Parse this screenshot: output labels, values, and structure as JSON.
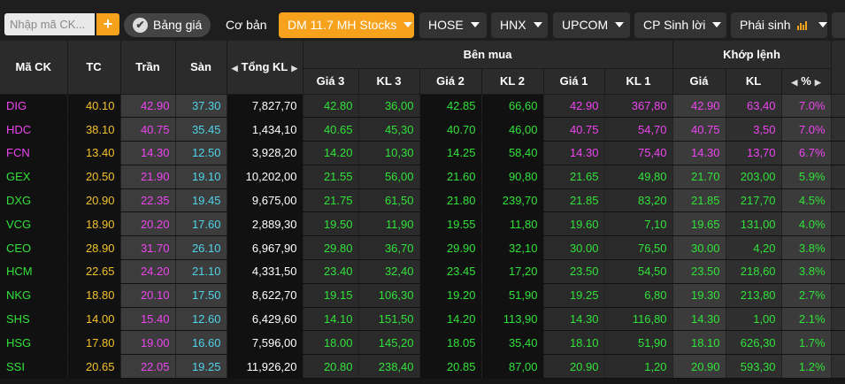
{
  "toolbar": {
    "search_placeholder": "Nhập mã CK...",
    "add_label": "+",
    "tabs": [
      {
        "label": "Bảng giá"
      },
      {
        "label": "Cơ bản"
      },
      {
        "label": "DM 11.7 MH Stocks"
      },
      {
        "label": "HOSE"
      },
      {
        "label": "HNX"
      },
      {
        "label": "UPCOM"
      },
      {
        "label": "CP Sinh lời"
      },
      {
        "label": "Phái sinh"
      }
    ]
  },
  "table": {
    "headers": {
      "symbol": "Mã CK",
      "ref": "TC",
      "ceil": "Trần",
      "floor": "Sàn",
      "total_vol": "Tổng KL",
      "buy_group": "Bên mua",
      "match_group": "Khớp lệnh",
      "p3": "Giá 3",
      "v3": "KL 3",
      "p2": "Giá 2",
      "v2": "KL 2",
      "p1": "Giá 1",
      "v1": "KL 1",
      "mp": "Giá",
      "mv": "KL",
      "pct": "%"
    },
    "rows": [
      {
        "sym": "DIG",
        "tc": "40.10",
        "tran": "42.90",
        "san": "37.30",
        "tkl": "7,827,70",
        "g3": "42.80",
        "kl3": "36,00",
        "g2": "42.85",
        "kl2": "66,60",
        "g1": "42.90",
        "kl1": "367,80",
        "gia": "42.90",
        "kl": "63,40",
        "pct": "7.0%",
        "sym_color": "magenta",
        "buy3": "green",
        "buy2": "green",
        "buy1": "magenta",
        "match": "magenta"
      },
      {
        "sym": "HDC",
        "tc": "38.10",
        "tran": "40.75",
        "san": "35.45",
        "tkl": "1,434,10",
        "g3": "40.65",
        "kl3": "45,30",
        "g2": "40.70",
        "kl2": "46,00",
        "g1": "40.75",
        "kl1": "54,70",
        "gia": "40.75",
        "kl": "3,50",
        "pct": "7.0%",
        "sym_color": "magenta",
        "buy3": "green",
        "buy2": "green",
        "buy1": "magenta",
        "match": "magenta"
      },
      {
        "sym": "FCN",
        "tc": "13.40",
        "tran": "14.30",
        "san": "12.50",
        "tkl": "3,928,20",
        "g3": "14.20",
        "kl3": "10,30",
        "g2": "14.25",
        "kl2": "58,40",
        "g1": "14.30",
        "kl1": "75,40",
        "gia": "14.30",
        "kl": "13,70",
        "pct": "6.7%",
        "sym_color": "magenta",
        "buy3": "green",
        "buy2": "green",
        "buy1": "magenta",
        "match": "magenta"
      },
      {
        "sym": "GEX",
        "tc": "20.50",
        "tran": "21.90",
        "san": "19.10",
        "tkl": "10,202,00",
        "g3": "21.55",
        "kl3": "56,00",
        "g2": "21.60",
        "kl2": "90,80",
        "g1": "21.65",
        "kl1": "49,80",
        "gia": "21.70",
        "kl": "203,00",
        "pct": "5.9%",
        "sym_color": "green",
        "buy3": "green",
        "buy2": "green",
        "buy1": "green",
        "match": "green"
      },
      {
        "sym": "DXG",
        "tc": "20.90",
        "tran": "22.35",
        "san": "19.45",
        "tkl": "9,675,00",
        "g3": "21.75",
        "kl3": "61,50",
        "g2": "21.80",
        "kl2": "239,70",
        "g1": "21.85",
        "kl1": "83,20",
        "gia": "21.85",
        "kl": "217,70",
        "pct": "4.5%",
        "sym_color": "green",
        "buy3": "green",
        "buy2": "green",
        "buy1": "green",
        "match": "green"
      },
      {
        "sym": "VCG",
        "tc": "18.90",
        "tran": "20.20",
        "san": "17.60",
        "tkl": "2,889,30",
        "g3": "19.50",
        "kl3": "11,90",
        "g2": "19.55",
        "kl2": "11,80",
        "g1": "19.60",
        "kl1": "7,10",
        "gia": "19.65",
        "kl": "131,00",
        "pct": "4.0%",
        "sym_color": "green",
        "buy3": "green",
        "buy2": "green",
        "buy1": "green",
        "match": "green"
      },
      {
        "sym": "CEO",
        "tc": "28.90",
        "tran": "31.70",
        "san": "26.10",
        "tkl": "6,967,90",
        "g3": "29.80",
        "kl3": "36,70",
        "g2": "29.90",
        "kl2": "32,10",
        "g1": "30.00",
        "kl1": "76,50",
        "gia": "30.00",
        "kl": "4,20",
        "pct": "3.8%",
        "sym_color": "green",
        "buy3": "green",
        "buy2": "green",
        "buy1": "green",
        "match": "green"
      },
      {
        "sym": "HCM",
        "tc": "22.65",
        "tran": "24.20",
        "san": "21.10",
        "tkl": "4,331,50",
        "g3": "23.40",
        "kl3": "32,40",
        "g2": "23.45",
        "kl2": "17,20",
        "g1": "23.50",
        "kl1": "54,50",
        "gia": "23.50",
        "kl": "218,60",
        "pct": "3.8%",
        "sym_color": "green",
        "buy3": "green",
        "buy2": "green",
        "buy1": "green",
        "match": "green"
      },
      {
        "sym": "NKG",
        "tc": "18.80",
        "tran": "20.10",
        "san": "17.50",
        "tkl": "8,622,70",
        "g3": "19.15",
        "kl3": "106,30",
        "g2": "19.20",
        "kl2": "51,90",
        "g1": "19.25",
        "kl1": "6,80",
        "gia": "19.30",
        "kl": "213,80",
        "pct": "2.7%",
        "sym_color": "green",
        "buy3": "green",
        "buy2": "green",
        "buy1": "green",
        "match": "green"
      },
      {
        "sym": "SHS",
        "tc": "14.00",
        "tran": "15.40",
        "san": "12.60",
        "tkl": "6,429,60",
        "g3": "14.10",
        "kl3": "151,50",
        "g2": "14.20",
        "kl2": "113,90",
        "g1": "14.30",
        "kl1": "116,80",
        "gia": "14.30",
        "kl": "1,00",
        "pct": "2.1%",
        "sym_color": "green",
        "buy3": "green",
        "buy2": "green",
        "buy1": "green",
        "match": "green"
      },
      {
        "sym": "HSG",
        "tc": "17.80",
        "tran": "19.00",
        "san": "16.60",
        "tkl": "7,596,00",
        "g3": "18.00",
        "kl3": "145,20",
        "g2": "18.05",
        "kl2": "35,40",
        "g1": "18.10",
        "kl1": "51,90",
        "gia": "18.10",
        "kl": "626,30",
        "pct": "1.7%",
        "sym_color": "green",
        "buy3": "green",
        "buy2": "green",
        "buy1": "green",
        "match": "green"
      },
      {
        "sym": "SSI",
        "tc": "20.65",
        "tran": "22.05",
        "san": "19.25",
        "tkl": "11,926,20",
        "g3": "20.80",
        "kl3": "238,40",
        "g2": "20.85",
        "kl2": "87,00",
        "g1": "20.90",
        "kl1": "1,20",
        "gia": "20.90",
        "kl": "593,30",
        "pct": "1.2%",
        "sym_color": "green",
        "buy3": "green",
        "buy2": "green",
        "buy1": "green",
        "match": "green"
      }
    ]
  },
  "colors": {
    "accent": "#f6a21c",
    "ceiling": "#ee45f0",
    "floor": "#4fd3e8",
    "reference": "#f3c12a",
    "up": "#31e23a"
  },
  "icons": {
    "sort_left": "triangle-left-icon",
    "sort_right": "triangle-right-icon",
    "bar_chart": "bar-chart-icon",
    "check": "check-icon",
    "dropdown": "chevron-down-icon"
  }
}
